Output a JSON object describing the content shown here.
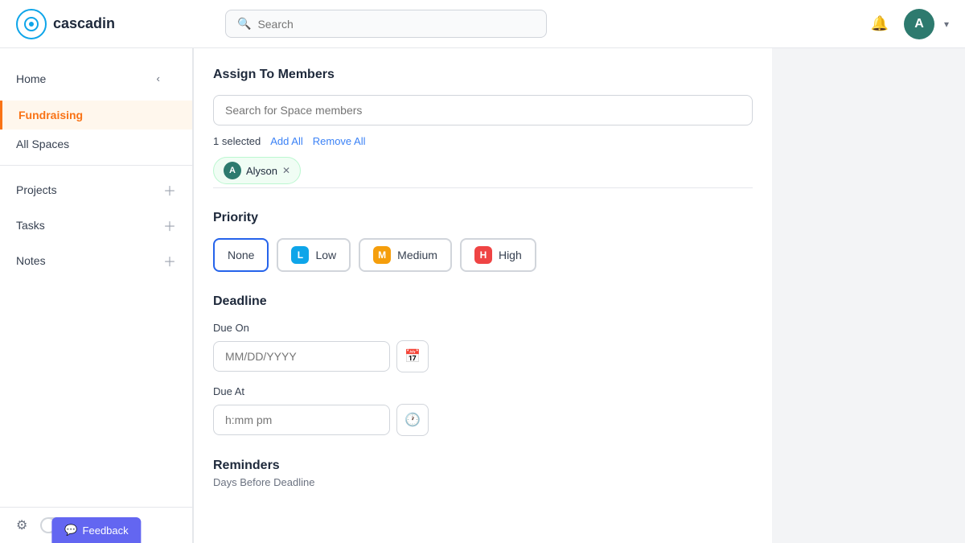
{
  "header": {
    "logo_text": "cascadin",
    "search_placeholder": "Search",
    "avatar_letter": "A",
    "bell_icon": "🔔"
  },
  "sidebar": {
    "home_label": "Home",
    "fundraising_label": "Fundraising",
    "all_spaces_label": "All Spaces",
    "projects_label": "Projects",
    "tasks_label": "Tasks",
    "notes_label": "Notes",
    "collapse_icon": "‹"
  },
  "bottom_bar": {
    "feedback_label": "Feedback"
  },
  "form": {
    "assign_title": "Assign To Members",
    "search_members_placeholder": "Search for Space members",
    "selected_count": "1 selected",
    "add_all_label": "Add All",
    "remove_all_label": "Remove All",
    "member_name": "Alyson",
    "member_letter": "A",
    "priority_title": "Priority",
    "priority_none": "None",
    "priority_low": "Low",
    "priority_low_letter": "L",
    "priority_medium": "Medium",
    "priority_medium_letter": "M",
    "priority_high": "High",
    "priority_high_letter": "H",
    "deadline_title": "Deadline",
    "due_on_label": "Due On",
    "due_on_placeholder": "MM/DD/YYYY",
    "due_at_label": "Due At",
    "due_at_placeholder": "h:mm pm",
    "reminders_title": "Reminders",
    "reminders_sub": "Days Before Deadline"
  }
}
